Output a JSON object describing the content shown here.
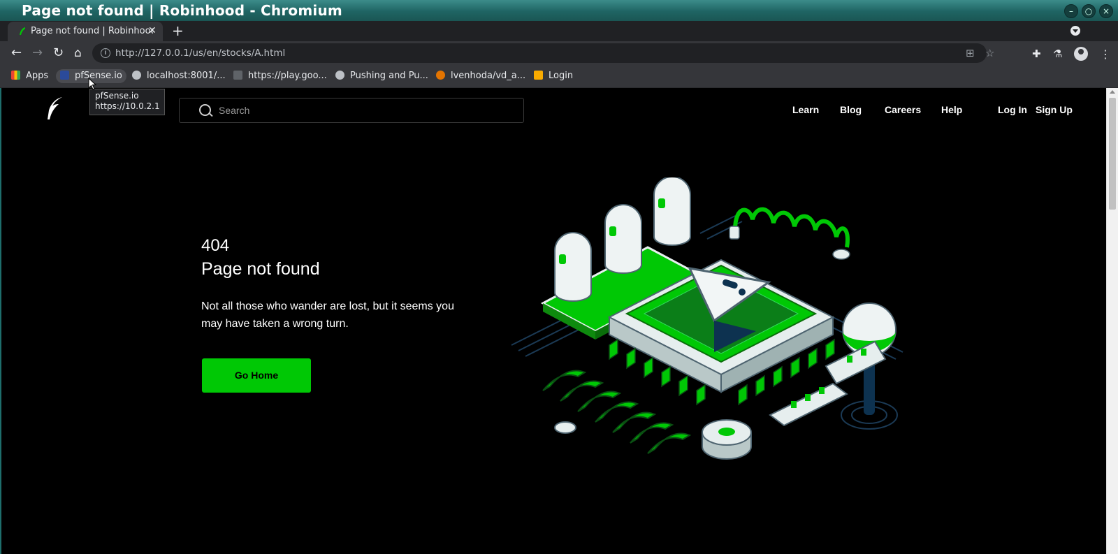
{
  "window": {
    "title": "Page not found | Robinhood - Chromium"
  },
  "tab": {
    "title": "Page not found | Robinhood"
  },
  "address_bar": {
    "url": "http://127.0.0.1/us/en/stocks/A.html"
  },
  "bookmarks": [
    {
      "label": "Apps",
      "icon": "apps-grid-icon"
    },
    {
      "label": "pfSense.io",
      "icon": "pfsense-icon"
    },
    {
      "label": "localhost:8001/...",
      "icon": "globe-icon"
    },
    {
      "label": "https://play.goo...",
      "icon": "play-icon"
    },
    {
      "label": "Pushing and Pu...",
      "icon": "globe-icon"
    },
    {
      "label": "lvenhoda/vd_a...",
      "icon": "github-icon"
    },
    {
      "label": "Login",
      "icon": "login-icon"
    }
  ],
  "tooltip": {
    "name": "pfSense.io",
    "url": "https://10.0.2.1"
  },
  "site": {
    "search_placeholder": "Search",
    "nav": [
      "Learn",
      "Blog",
      "Careers",
      "Help",
      "Log In",
      "Sign Up"
    ]
  },
  "error": {
    "code": "404",
    "heading": "Page not found",
    "message": "Not all those who wander are lost, but it seems you may have taken a wrong turn.",
    "button": "Go Home"
  },
  "colors": {
    "brand_green": "#00c805",
    "background": "#000000"
  }
}
